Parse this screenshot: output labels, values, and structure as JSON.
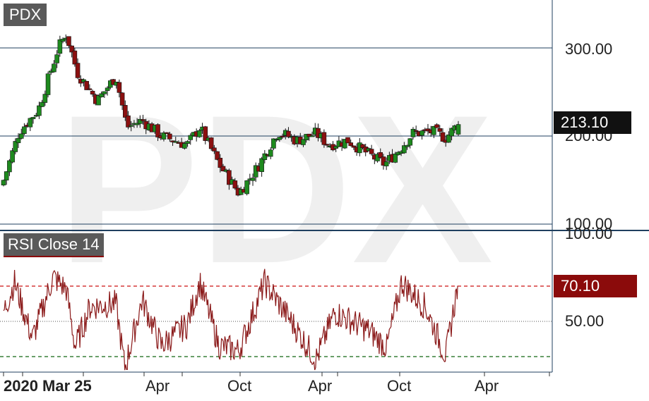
{
  "ticker": "PDX",
  "rsi_label": "RSI Close 14",
  "last_price_label": "213.10",
  "last_rsi_label": "70.10",
  "price_axis_labels": [
    "300.00",
    "200.00",
    "100.00"
  ],
  "rsi_axis_labels": [
    "100.00",
    "50.00"
  ],
  "x_axis_labels": [
    "2020 Mar 25",
    "Apr",
    "Oct",
    "Apr",
    "Oct",
    "Apr"
  ],
  "colors": {
    "up": "#1e8a1e",
    "down": "#8b1010",
    "rsi_line": "#8b1a1a",
    "overbought": "#cc1111",
    "oversold": "#116611",
    "grid": "#1f3f5f",
    "watermark": "#eeeeee"
  },
  "chart_data": [
    {
      "type": "candlestick",
      "title": "PDX",
      "ylim": [
        88,
        325
      ],
      "y_ticks": [
        100,
        200,
        300
      ],
      "last_value": 213.1,
      "key_points": [
        {
          "date": "2020-03-25",
          "close": 150
        },
        {
          "date": "2020-05-01",
          "close": 205
        },
        {
          "date": "2020-06-15",
          "close": 230
        },
        {
          "date": "2020-08-01",
          "close": 300
        },
        {
          "date": "2020-08-20",
          "close": 316
        },
        {
          "date": "2020-09-15",
          "close": 272
        },
        {
          "date": "2020-11-01",
          "close": 240
        },
        {
          "date": "2020-12-15",
          "close": 268
        },
        {
          "date": "2021-01-10",
          "close": 210
        },
        {
          "date": "2021-02-15",
          "close": 218
        },
        {
          "date": "2021-04-01",
          "close": 200
        },
        {
          "date": "2021-06-01",
          "close": 190
        },
        {
          "date": "2021-07-01",
          "close": 210
        },
        {
          "date": "2021-08-15",
          "close": 168
        },
        {
          "date": "2021-10-01",
          "close": 135
        },
        {
          "date": "2021-11-15",
          "close": 165
        },
        {
          "date": "2022-01-01",
          "close": 205
        },
        {
          "date": "2022-02-15",
          "close": 195
        },
        {
          "date": "2022-04-01",
          "close": 203
        },
        {
          "date": "2022-05-01",
          "close": 190
        },
        {
          "date": "2022-06-15",
          "close": 195
        },
        {
          "date": "2022-08-01",
          "close": 180
        },
        {
          "date": "2022-09-10",
          "close": 168
        },
        {
          "date": "2022-10-15",
          "close": 185
        },
        {
          "date": "2022-11-15",
          "close": 203
        },
        {
          "date": "2023-01-01",
          "close": 205
        },
        {
          "date": "2023-02-01",
          "close": 198
        },
        {
          "date": "2023-03-01",
          "close": 213.1
        }
      ]
    },
    {
      "type": "line",
      "title": "RSI Close 14",
      "ylim": [
        0,
        100
      ],
      "reference_lines": [
        30,
        70
      ],
      "last_value": 70.1,
      "key_points": [
        {
          "date": "2020-03-25",
          "rsi": 55
        },
        {
          "date": "2020-04-20",
          "rsi": 72
        },
        {
          "date": "2020-06-01",
          "rsi": 40
        },
        {
          "date": "2020-07-20",
          "rsi": 75
        },
        {
          "date": "2020-08-20",
          "rsi": 68
        },
        {
          "date": "2020-09-10",
          "rsi": 35
        },
        {
          "date": "2020-10-15",
          "rsi": 58
        },
        {
          "date": "2020-12-15",
          "rsi": 60
        },
        {
          "date": "2021-01-05",
          "rsi": 23
        },
        {
          "date": "2021-02-15",
          "rsi": 62
        },
        {
          "date": "2021-04-01",
          "rsi": 36
        },
        {
          "date": "2021-06-01",
          "rsi": 48
        },
        {
          "date": "2021-07-01",
          "rsi": 72
        },
        {
          "date": "2021-08-15",
          "rsi": 36
        },
        {
          "date": "2021-10-01",
          "rsi": 33
        },
        {
          "date": "2021-12-01",
          "rsi": 72
        },
        {
          "date": "2022-02-01",
          "rsi": 50
        },
        {
          "date": "2022-04-01",
          "rsi": 28
        },
        {
          "date": "2022-05-15",
          "rsi": 55
        },
        {
          "date": "2022-08-01",
          "rsi": 45
        },
        {
          "date": "2022-09-15",
          "rsi": 35
        },
        {
          "date": "2022-10-20",
          "rsi": 72
        },
        {
          "date": "2022-12-15",
          "rsi": 58
        },
        {
          "date": "2023-02-01",
          "rsi": 30
        },
        {
          "date": "2023-03-01",
          "rsi": 70.1
        }
      ]
    }
  ]
}
